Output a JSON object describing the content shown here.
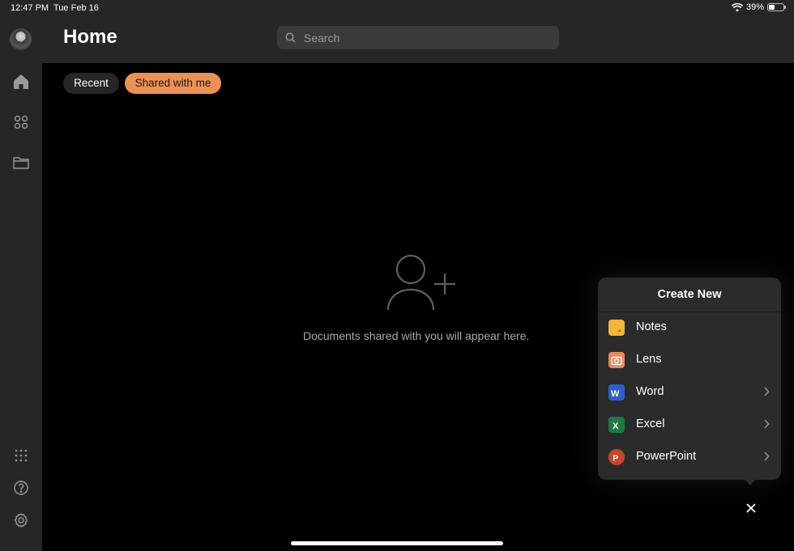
{
  "status": {
    "time": "12:47 PM",
    "date": "Tue Feb 16",
    "battery": "39%",
    "battery_level": 0.39
  },
  "header": {
    "title": "Home",
    "search_placeholder": "Search"
  },
  "filters": [
    {
      "label": "Recent",
      "selected": false
    },
    {
      "label": "Shared with me",
      "selected": true
    }
  ],
  "sidebar": {
    "top_icons": [
      "home-icon",
      "apps-icon",
      "folder-icon"
    ],
    "bottom_icons": [
      "app-grid-icon",
      "help-icon",
      "settings-icon"
    ]
  },
  "empty_state": {
    "icon": "add-person-icon",
    "message": "Documents shared with you will appear here."
  },
  "create_new": {
    "title": "Create New",
    "items": [
      {
        "label": "Notes",
        "icon": "notes-icon",
        "color": "#f2b63c",
        "has_submenu": false
      },
      {
        "label": "Lens",
        "icon": "lens-icon",
        "color": "#e8875a",
        "has_submenu": false
      },
      {
        "label": "Word",
        "icon": "word-icon",
        "color": "#2b5fc7",
        "has_submenu": true
      },
      {
        "label": "Excel",
        "icon": "excel-icon",
        "color": "#1e7a45",
        "has_submenu": true
      },
      {
        "label": "PowerPoint",
        "icon": "powerpoint-icon",
        "color": "#c9472a",
        "has_submenu": true
      }
    ]
  },
  "colors": {
    "accent": "#ec9155",
    "background": "#000000",
    "chrome": "#262626"
  }
}
